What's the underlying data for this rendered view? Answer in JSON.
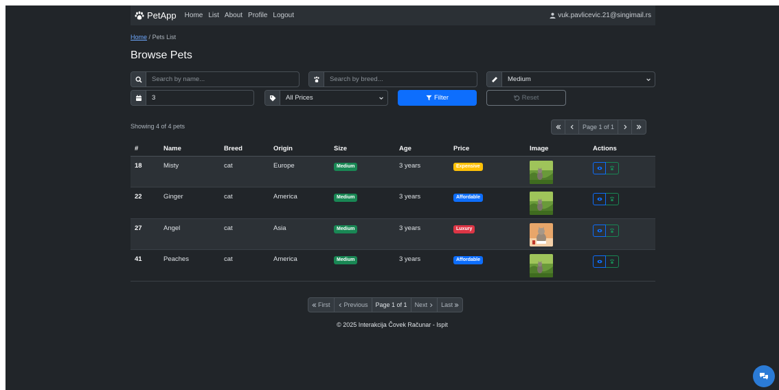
{
  "navbar": {
    "brand": "PetApp",
    "links": [
      "Home",
      "List",
      "About",
      "Profile",
      "Logout"
    ],
    "user_email": "vuk.pavlicevic.21@singimail.rs"
  },
  "breadcrumb": {
    "home": "Home",
    "separator": "/",
    "current": "Pets List"
  },
  "page_title": "Browse Pets",
  "filters": {
    "name_placeholder": "Search by name...",
    "breed_placeholder": "Search by breed...",
    "size_value": "Medium",
    "age_value": "3",
    "price_value": "All Prices",
    "filter_label": "Filter",
    "reset_label": "Reset"
  },
  "results": {
    "showing_text": "Showing 4 of 4 pets",
    "page_info": "Page 1 of 1"
  },
  "table": {
    "headers": [
      "#",
      "Name",
      "Breed",
      "Origin",
      "Size",
      "Age",
      "Price",
      "Image",
      "Actions"
    ],
    "rows": [
      {
        "id": "18",
        "name": "Misty",
        "breed": "cat",
        "origin": "Europe",
        "size": "Medium",
        "age": "3 years",
        "price": "Expensive",
        "price_color": "#ffc107",
        "image": "grass-cat"
      },
      {
        "id": "22",
        "name": "Ginger",
        "breed": "cat",
        "origin": "America",
        "size": "Medium",
        "age": "3 years",
        "price": "Affordable",
        "price_color": "#0d6efd",
        "image": "grass-cat"
      },
      {
        "id": "27",
        "name": "Angel",
        "breed": "cat",
        "origin": "Asia",
        "size": "Medium",
        "age": "3 years",
        "price": "Luxury",
        "price_color": "#dc3545",
        "image": "sitting-cat"
      },
      {
        "id": "41",
        "name": "Peaches",
        "breed": "cat",
        "origin": "America",
        "size": "Medium",
        "age": "3 years",
        "price": "Affordable",
        "price_color": "#0d6efd",
        "image": "grass-cat"
      }
    ]
  },
  "pager": {
    "first": "First",
    "previous": "Previous",
    "page_info": "Page 1 of 1",
    "next": "Next",
    "last": "Last"
  },
  "footer": "© 2025 Interakcija Čovek Računar - Ispit",
  "colors": {
    "size_badge": "#198754",
    "primary": "#0d6efd",
    "background": "#212529"
  }
}
